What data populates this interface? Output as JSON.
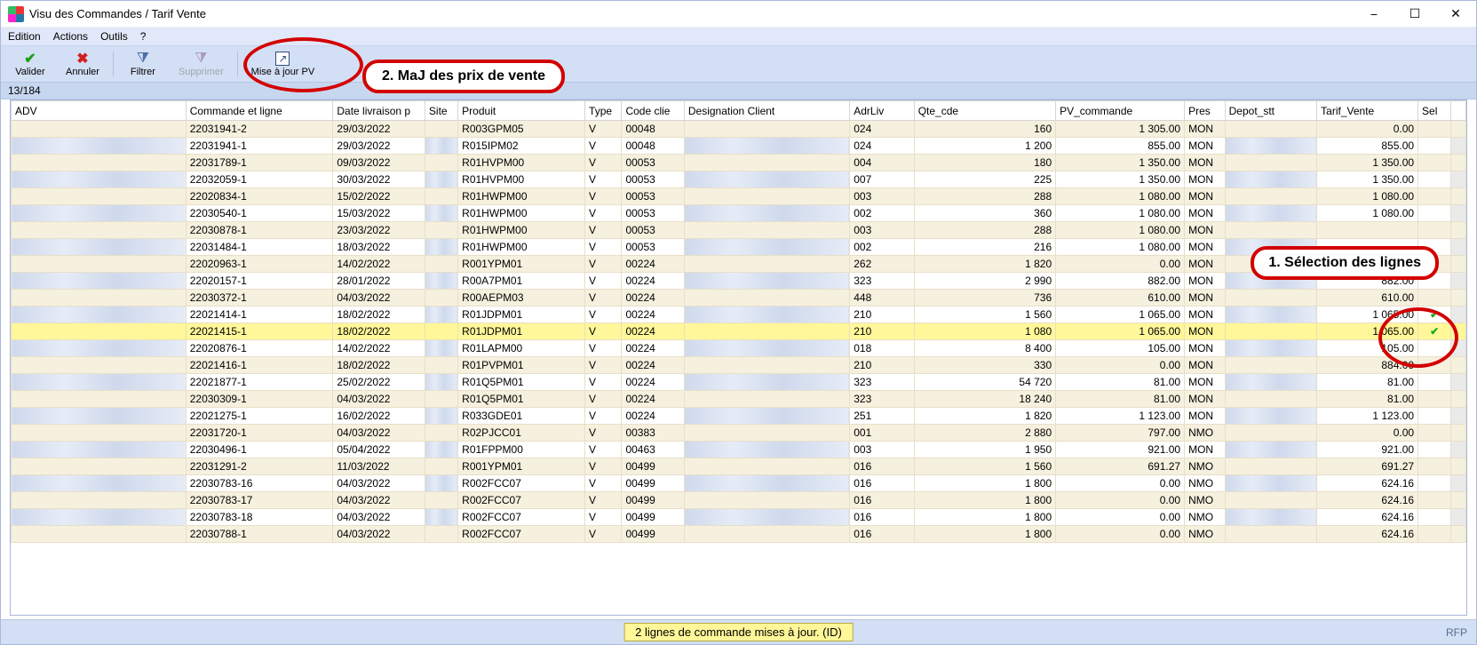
{
  "window": {
    "title": "Visu des Commandes / Tarif Vente"
  },
  "menu": {
    "edition": "Edition",
    "actions": "Actions",
    "outils": "Outils",
    "help": "?"
  },
  "toolbar": {
    "valider": "Valider",
    "annuler": "Annuler",
    "filtrer": "Filtrer",
    "supprimer": "Supprimer",
    "majpv": "Mise à jour PV"
  },
  "callouts": {
    "step1": "1. Sélection des lignes",
    "step2": "2. MaJ des prix de vente"
  },
  "count": "13/184",
  "columns": {
    "adv": "ADV",
    "cmd": "Commande et ligne",
    "date": "Date livraison p",
    "site": "Site",
    "prod": "Produit",
    "type": "Type",
    "code": "Code clie",
    "desig": "Designation Client",
    "adr": "AdrLiv",
    "qte": "Qte_cde",
    "pv": "PV_commande",
    "pres": "Pres",
    "depot": "Depot_stt",
    "tarif": "Tarif_Vente",
    "sel": "Sel"
  },
  "rows": [
    {
      "cmd": "22031941-2",
      "date": "29/03/2022",
      "prod": "R003GPM05",
      "type": "V",
      "code": "00048",
      "adr": "024",
      "qte": "160",
      "pv": "1 305.00",
      "pres": "MON",
      "tarif": "0.00",
      "sel": false,
      "hl": false
    },
    {
      "cmd": "22031941-1",
      "date": "29/03/2022",
      "prod": "R015IPM02",
      "type": "V",
      "code": "00048",
      "adr": "024",
      "qte": "1 200",
      "pv": "855.00",
      "pres": "MON",
      "tarif": "855.00",
      "sel": false,
      "hl": false
    },
    {
      "cmd": "22031789-1",
      "date": "09/03/2022",
      "prod": "R01HVPM00",
      "type": "V",
      "code": "00053",
      "adr": "004",
      "qte": "180",
      "pv": "1 350.00",
      "pres": "MON",
      "tarif": "1 350.00",
      "sel": false,
      "hl": false
    },
    {
      "cmd": "22032059-1",
      "date": "30/03/2022",
      "prod": "R01HVPM00",
      "type": "V",
      "code": "00053",
      "adr": "007",
      "qte": "225",
      "pv": "1 350.00",
      "pres": "MON",
      "tarif": "1 350.00",
      "sel": false,
      "hl": false
    },
    {
      "cmd": "22020834-1",
      "date": "15/02/2022",
      "prod": "R01HWPM00",
      "type": "V",
      "code": "00053",
      "adr": "003",
      "qte": "288",
      "pv": "1 080.00",
      "pres": "MON",
      "tarif": "1 080.00",
      "sel": false,
      "hl": false
    },
    {
      "cmd": "22030540-1",
      "date": "15/03/2022",
      "prod": "R01HWPM00",
      "type": "V",
      "code": "00053",
      "adr": "002",
      "qte": "360",
      "pv": "1 080.00",
      "pres": "MON",
      "tarif": "1 080.00",
      "sel": false,
      "hl": false
    },
    {
      "cmd": "22030878-1",
      "date": "23/03/2022",
      "prod": "R01HWPM00",
      "type": "V",
      "code": "00053",
      "adr": "003",
      "qte": "288",
      "pv": "1 080.00",
      "pres": "MON",
      "tarif": "",
      "sel": false,
      "hl": false
    },
    {
      "cmd": "22031484-1",
      "date": "18/03/2022",
      "prod": "R01HWPM00",
      "type": "V",
      "code": "00053",
      "adr": "002",
      "qte": "216",
      "pv": "1 080.00",
      "pres": "MON",
      "tarif": "",
      "sel": false,
      "hl": false
    },
    {
      "cmd": "22020963-1",
      "date": "14/02/2022",
      "prod": "R001YPM01",
      "type": "V",
      "code": "00224",
      "adr": "262",
      "qte": "1 820",
      "pv": "0.00",
      "pres": "MON",
      "tarif": "",
      "sel": false,
      "hl": false
    },
    {
      "cmd": "22020157-1",
      "date": "28/01/2022",
      "prod": "R00A7PM01",
      "type": "V",
      "code": "00224",
      "adr": "323",
      "qte": "2 990",
      "pv": "882.00",
      "pres": "MON",
      "tarif": "882.00",
      "sel": false,
      "hl": false
    },
    {
      "cmd": "22030372-1",
      "date": "04/03/2022",
      "prod": "R00AEPM03",
      "type": "V",
      "code": "00224",
      "adr": "448",
      "qte": "736",
      "pv": "610.00",
      "pres": "MON",
      "tarif": "610.00",
      "sel": false,
      "hl": false
    },
    {
      "cmd": "22021414-1",
      "date": "18/02/2022",
      "prod": "R01JDPM01",
      "type": "V",
      "code": "00224",
      "adr": "210",
      "qte": "1 560",
      "pv": "1 065.00",
      "pres": "MON",
      "tarif": "1 065.00",
      "sel": true,
      "hl": false
    },
    {
      "cmd": "22021415-1",
      "date": "18/02/2022",
      "prod": "R01JDPM01",
      "type": "V",
      "code": "00224",
      "adr": "210",
      "qte": "1 080",
      "pv": "1 065.00",
      "pres": "MON",
      "tarif": "1 065.00",
      "sel": true,
      "hl": true
    },
    {
      "cmd": "22020876-1",
      "date": "14/02/2022",
      "prod": "R01LAPM00",
      "type": "V",
      "code": "00224",
      "adr": "018",
      "qte": "8 400",
      "pv": "105.00",
      "pres": "MON",
      "tarif": "105.00",
      "sel": false,
      "hl": false
    },
    {
      "cmd": "22021416-1",
      "date": "18/02/2022",
      "prod": "R01PVPM01",
      "type": "V",
      "code": "00224",
      "adr": "210",
      "qte": "330",
      "pv": "0.00",
      "pres": "MON",
      "tarif": "884.00",
      "sel": false,
      "hl": false
    },
    {
      "cmd": "22021877-1",
      "date": "25/02/2022",
      "prod": "R01Q5PM01",
      "type": "V",
      "code": "00224",
      "adr": "323",
      "qte": "54 720",
      "pv": "81.00",
      "pres": "MON",
      "tarif": "81.00",
      "sel": false,
      "hl": false
    },
    {
      "cmd": "22030309-1",
      "date": "04/03/2022",
      "prod": "R01Q5PM01",
      "type": "V",
      "code": "00224",
      "adr": "323",
      "qte": "18 240",
      "pv": "81.00",
      "pres": "MON",
      "tarif": "81.00",
      "sel": false,
      "hl": false
    },
    {
      "cmd": "22021275-1",
      "date": "16/02/2022",
      "prod": "R033GDE01",
      "type": "V",
      "code": "00224",
      "adr": "251",
      "qte": "1 820",
      "pv": "1 123.00",
      "pres": "MON",
      "tarif": "1 123.00",
      "sel": false,
      "hl": false
    },
    {
      "cmd": "22031720-1",
      "date": "04/03/2022",
      "prod": "R02PJCC01",
      "type": "V",
      "code": "00383",
      "adr": "001",
      "qte": "2 880",
      "pv": "797.00",
      "pres": "NMO",
      "tarif": "0.00",
      "sel": false,
      "hl": false
    },
    {
      "cmd": "22030496-1",
      "date": "05/04/2022",
      "prod": "R01FPPM00",
      "type": "V",
      "code": "00463",
      "adr": "003",
      "qte": "1 950",
      "pv": "921.00",
      "pres": "MON",
      "tarif": "921.00",
      "sel": false,
      "hl": false
    },
    {
      "cmd": "22031291-2",
      "date": "11/03/2022",
      "prod": "R001YPM01",
      "type": "V",
      "code": "00499",
      "adr": "016",
      "qte": "1 560",
      "pv": "691.27",
      "pres": "NMO",
      "tarif": "691.27",
      "sel": false,
      "hl": false
    },
    {
      "cmd": "22030783-16",
      "date": "04/03/2022",
      "prod": "R002FCC07",
      "type": "V",
      "code": "00499",
      "adr": "016",
      "qte": "1 800",
      "pv": "0.00",
      "pres": "NMO",
      "tarif": "624.16",
      "sel": false,
      "hl": false
    },
    {
      "cmd": "22030783-17",
      "date": "04/03/2022",
      "prod": "R002FCC07",
      "type": "V",
      "code": "00499",
      "adr": "016",
      "qte": "1 800",
      "pv": "0.00",
      "pres": "NMO",
      "tarif": "624.16",
      "sel": false,
      "hl": false
    },
    {
      "cmd": "22030783-18",
      "date": "04/03/2022",
      "prod": "R002FCC07",
      "type": "V",
      "code": "00499",
      "adr": "016",
      "qte": "1 800",
      "pv": "0.00",
      "pres": "NMO",
      "tarif": "624.16",
      "sel": false,
      "hl": false
    },
    {
      "cmd": "22030788-1",
      "date": "04/03/2022",
      "prod": "R002FCC07",
      "type": "V",
      "code": "00499",
      "adr": "016",
      "qte": "1 800",
      "pv": "0.00",
      "pres": "NMO",
      "tarif": "624.16",
      "sel": false,
      "hl": false
    }
  ],
  "status": {
    "message": "2 lignes de commande mises à jour. (ID)",
    "right": "RFP"
  }
}
